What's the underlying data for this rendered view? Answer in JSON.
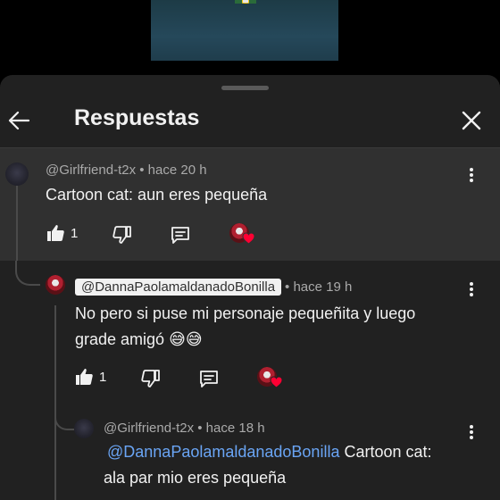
{
  "header": {
    "title": "Respuestas"
  },
  "icons": {
    "back": "arrow-back-icon",
    "close": "close-icon",
    "like": "thumbs-up-icon",
    "dislike": "thumbs-down-icon",
    "reply": "reply-comment-icon",
    "more": "more-vertical-icon",
    "creator_heart": "creator-heart-icon"
  },
  "colors": {
    "sheet_bg": "#212121",
    "highlight_bg": "#303030",
    "text_primary": "#f1f1f1",
    "text_secondary": "#aaaaaa",
    "mention": "#6aa5f5",
    "heart": "#ff0033"
  },
  "parent_comment": {
    "author": "@Girlfriend-t2x",
    "time": "• hace 20 h",
    "text": "Cartoon cat: aun eres pequeña",
    "likes": "1"
  },
  "reply_1": {
    "author": "@DannaPaolamaldanadoBonilla",
    "time": "• hace 19 h",
    "text_line1": "No pero si puse mi personaje pequeñita y luego",
    "text_line2": "grade amigó 😅😅",
    "likes": "1"
  },
  "reply_2": {
    "author": "@Girlfriend-t2x",
    "time": "• hace 18 h",
    "mention": "@DannaPaolamaldanadoBonilla",
    "text_after_mention": " Cartoon cat:",
    "text_line2": "ala par mio eres pequeña"
  }
}
